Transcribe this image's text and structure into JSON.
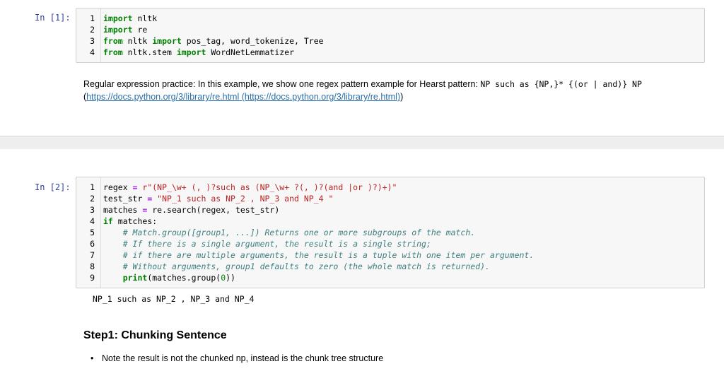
{
  "cell1": {
    "prompt": "In [1]:",
    "lines": [
      {
        "n": "1",
        "segs": [
          {
            "t": "import",
            "c": "kw"
          },
          {
            "t": " nltk",
            "c": ""
          }
        ]
      },
      {
        "n": "2",
        "segs": [
          {
            "t": "import",
            "c": "kw"
          },
          {
            "t": " re",
            "c": ""
          }
        ]
      },
      {
        "n": "3",
        "segs": [
          {
            "t": "from",
            "c": "kw"
          },
          {
            "t": " nltk ",
            "c": ""
          },
          {
            "t": "import",
            "c": "kw"
          },
          {
            "t": " pos_tag, word_tokenize, Tree",
            "c": ""
          }
        ]
      },
      {
        "n": "4",
        "segs": [
          {
            "t": "from",
            "c": "kw"
          },
          {
            "t": " nltk.stem ",
            "c": ""
          },
          {
            "t": "import",
            "c": "kw"
          },
          {
            "t": " WordNetLemmatizer",
            "c": ""
          }
        ]
      }
    ]
  },
  "markdown1": {
    "text": "Regular expression practice: In this example, we show one regex pattern example for Hearst pattern: ",
    "pattern": "NP such as {NP,}* {(or | and)} NP",
    "link_text": "https://docs.python.org/3/library/re.html",
    "link_suffix": " (https://docs.python.org/3/library/re.html))",
    "open_paren": "("
  },
  "cell2": {
    "prompt": "In [2]:",
    "lines": [
      {
        "n": "1",
        "segs": [
          {
            "t": "regex ",
            "c": ""
          },
          {
            "t": "=",
            "c": "op"
          },
          {
            "t": " r\"(NP_\\w+ (, )?such as (NP_\\w+ ?(, )?(and |or )?)+)\"",
            "c": "str"
          }
        ]
      },
      {
        "n": "2",
        "segs": [
          {
            "t": "test_str ",
            "c": ""
          },
          {
            "t": "=",
            "c": "op"
          },
          {
            "t": " \"NP_1 such as NP_2 , NP_3 and NP_4 \"",
            "c": "str"
          }
        ]
      },
      {
        "n": "3",
        "segs": [
          {
            "t": "matches ",
            "c": ""
          },
          {
            "t": "=",
            "c": "op"
          },
          {
            "t": " re.search(regex, test_str)",
            "c": ""
          }
        ]
      },
      {
        "n": "4",
        "segs": [
          {
            "t": "if",
            "c": "kw"
          },
          {
            "t": " matches:",
            "c": ""
          }
        ]
      },
      {
        "n": "5",
        "segs": [
          {
            "t": "    ",
            "c": ""
          },
          {
            "t": "# Match.group([group1, ...]) Returns one or more subgroups of the match.",
            "c": "cmt"
          }
        ]
      },
      {
        "n": "6",
        "segs": [
          {
            "t": "    ",
            "c": ""
          },
          {
            "t": "# If there is a single argument, the result is a single string;",
            "c": "cmt"
          }
        ]
      },
      {
        "n": "7",
        "segs": [
          {
            "t": "    ",
            "c": ""
          },
          {
            "t": "# if there are multiple arguments, the result is a tuple with one item per argument.",
            "c": "cmt"
          }
        ]
      },
      {
        "n": "8",
        "segs": [
          {
            "t": "    ",
            "c": ""
          },
          {
            "t": "# Without arguments, group1 defaults to zero (the whole match is returned).",
            "c": "cmt"
          }
        ]
      },
      {
        "n": "9",
        "segs": [
          {
            "t": "    ",
            "c": ""
          },
          {
            "t": "print",
            "c": "kw"
          },
          {
            "t": "(matches.group(",
            "c": ""
          },
          {
            "t": "0",
            "c": "num"
          },
          {
            "t": "))",
            "c": ""
          }
        ]
      }
    ]
  },
  "output2": "NP_1 such as NP_2 , NP_3 and NP_4",
  "heading": "Step1: Chunking Sentence",
  "bullet": "Note the result is not the chunked np, instead is the chunk tree structure"
}
